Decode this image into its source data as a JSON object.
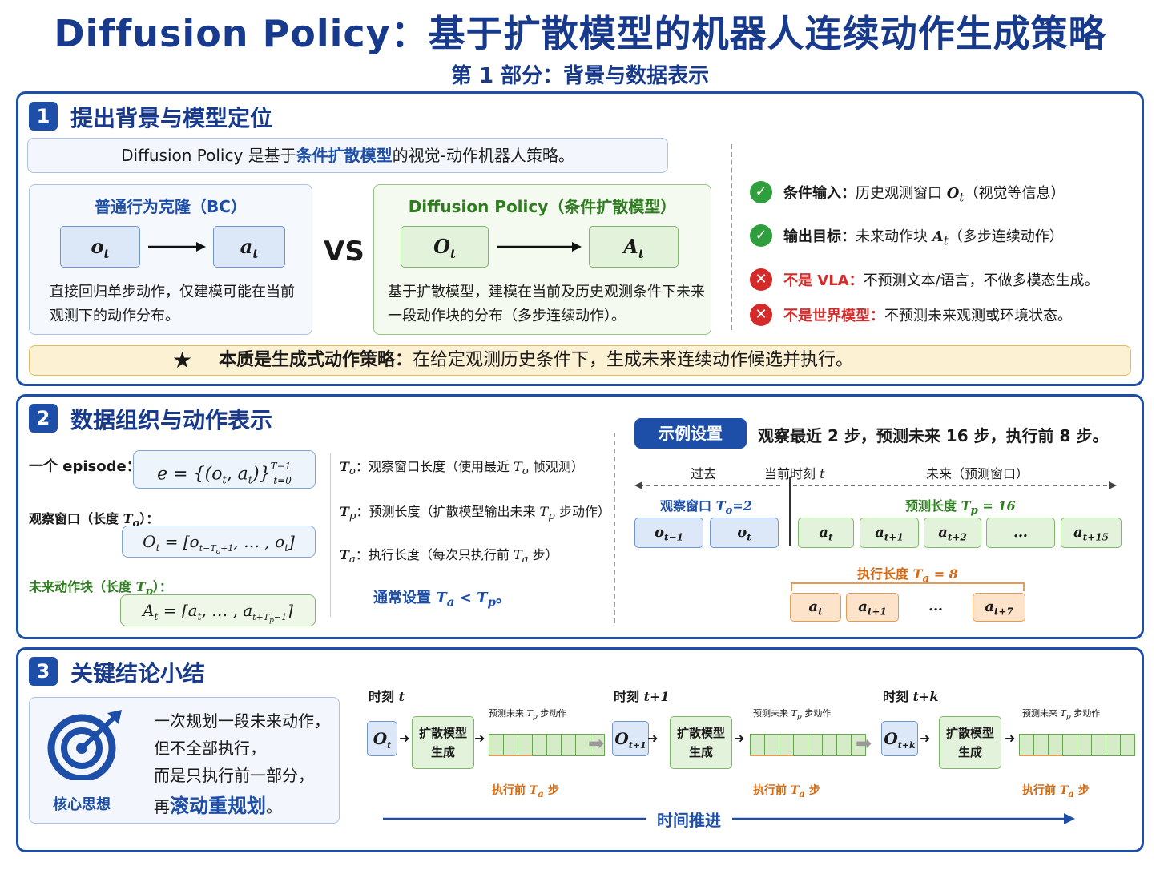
{
  "header": {
    "title": "Diffusion Policy：基于扩散模型的机器人连续动作生成策略",
    "subtitle": "第 1 部分：背景与数据表示"
  },
  "section1": {
    "number": "1",
    "heading": "提出背景与模型定位",
    "intro_pre": "Diffusion Policy 是基于",
    "intro_hl": "条件扩散模型",
    "intro_post": "的视觉-动作机器人策略。",
    "bc": {
      "title": "普通行为克隆（BC）",
      "in": "o",
      "in_sub": "t",
      "out": "a",
      "out_sub": "t",
      "desc": "直接回归单步动作，仅建模可能在当前观测下的动作分布。"
    },
    "vs": "VS",
    "dp": {
      "title": "Diffusion Policy（条件扩散模型）",
      "in": "O",
      "in_sub": "t",
      "out": "A",
      "out_sub": "t",
      "desc": "基于扩散模型，建模在当前及历史观测条件下未来一段动作块的分布（多步连续动作）。"
    },
    "points": [
      {
        "label": "条件输入：",
        "text_pre": "历史观测窗口 ",
        "sym": "O",
        "sym_sub": "t",
        "text_post": "（视觉等信息）"
      },
      {
        "label": "输出目标：",
        "text_pre": "未来动作块 ",
        "sym": "A",
        "sym_sub": "t",
        "text_post": "（多步连续动作）"
      },
      {
        "label": "不是 VLA：",
        "text": "不预测文本/语言，不做多模态生成。"
      },
      {
        "label": "不是世界模型：",
        "text": "不预测未来观测或环境状态。"
      }
    ],
    "essence_label": "本质是生成式动作策略：",
    "essence_text": "在给定观测历史条件下，生成未来连续动作候选并执行。"
  },
  "section2": {
    "number": "2",
    "heading": "数据组织与动作表示",
    "episode_label": "一个 episode：",
    "episode_formula": "e = {(o",
    "obs_label": "观察窗口（长度 ",
    "obs_label_sym": "T",
    "obs_label_sub": "o",
    "obs_label_end": "）：",
    "future_label": "未来动作块（长度 ",
    "future_label_sym": "T",
    "future_label_sub": "p",
    "future_label_end": "）：",
    "defs": [
      {
        "sym": "T",
        "sub": "o",
        "text": "：观察窗口长度（使用最近 ",
        "sym2": "T",
        "sub2": "o",
        "text2": " 帧观测）"
      },
      {
        "sym": "T",
        "sub": "p",
        "text": "：预测长度（扩散模型输出未来 ",
        "sym2": "T",
        "sub2": "p",
        "text2": " 步动作）"
      },
      {
        "sym": "T",
        "sub": "a",
        "text": "：执行长度（每次只执行前 ",
        "sym2": "T",
        "sub2": "a",
        "text2": " 步）"
      }
    ],
    "usual": "通常设置 ",
    "example_badge": "示例设置",
    "example_text": "观察最近 2 步，预测未来 16 步，执行前 8 步。",
    "past_label": "过去",
    "now_label": "当前时刻 ",
    "now_sym": "t",
    "future_window_label": "未来（预测窗口）",
    "obs_window_label": "观察窗口 ",
    "obs_window_val": "=2",
    "pred_len_label": "预测长度 ",
    "pred_len_val": " = 16",
    "exec_len_label": "执行长度 ",
    "exec_len_val": " = 8",
    "obs_cells": [
      {
        "b": "o",
        "s": "t−1"
      },
      {
        "b": "o",
        "s": "t"
      }
    ],
    "pred_cells": [
      {
        "b": "a",
        "s": "t"
      },
      {
        "b": "a",
        "s": "t+1"
      },
      {
        "b": "a",
        "s": "t+2"
      },
      {
        "b": "…",
        "s": ""
      },
      {
        "b": "a",
        "s": "t+15"
      }
    ],
    "exec_cells": [
      {
        "b": "a",
        "s": "t"
      },
      {
        "b": "a",
        "s": "t+1"
      },
      {
        "b": "…",
        "s": ""
      },
      {
        "b": "a",
        "s": "t+7"
      }
    ]
  },
  "section3": {
    "number": "3",
    "heading": "关键结论小结",
    "core_label": "核心思想",
    "core_lines": [
      "一次规划一段未来动作，",
      "但不全部执行，",
      "而是只执行前一部分，"
    ],
    "core_last_pre": "再",
    "core_last_hl": "滚动重规划",
    "core_last_post": "。",
    "steps": [
      {
        "time": "时刻 ",
        "time_sym": "t",
        "obs": "O",
        "obs_sub": "t"
      },
      {
        "time": "时刻 ",
        "time_sym": "t+1",
        "obs": "O",
        "obs_sub": "t+1"
      },
      {
        "time": "时刻 ",
        "time_sym": "t+k",
        "obs": "O",
        "obs_sub": "t+k"
      }
    ],
    "model_label_1": "扩散模型",
    "model_label_2": "生成",
    "pred_caption": "预测未来 ",
    "pred_caption_end": " 步动作",
    "exec_caption": "执行前 ",
    "exec_caption_end": " 步",
    "timeline": "时间推进"
  },
  "colors": {
    "primary": "#1d4ea8",
    "green": "#2f9e3c",
    "red": "#d42a2a",
    "orange": "#d66a12"
  }
}
